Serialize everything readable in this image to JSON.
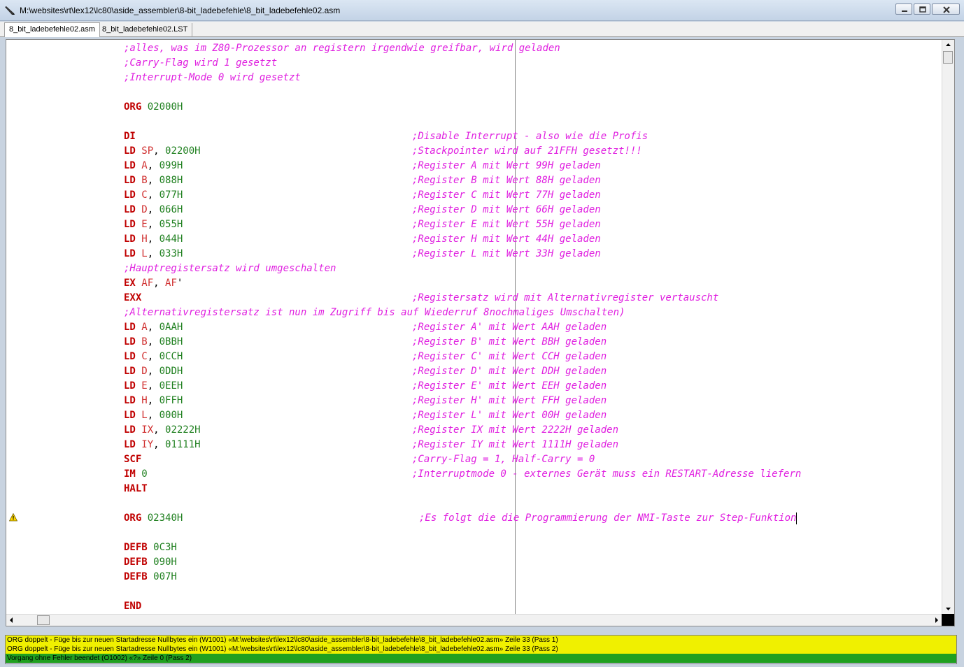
{
  "window": {
    "title": "M:\\websites\\rt\\lex12\\lc80\\aside_assembler\\8-bit_ladebefehle\\8_bit_ladebefehle02.asm"
  },
  "tabs": [
    {
      "label": "8_bit_ladebefehle02.asm",
      "active": true
    },
    {
      "label": "8_bit_ladebefehle02.LST",
      "active": false
    }
  ],
  "icons": {
    "app": "pencil-icon",
    "warning": "warning-icon",
    "minimize": "minimize-icon",
    "maximize": "maximize-icon",
    "close": "close-icon"
  },
  "colors": {
    "comment": "#e020e0",
    "keyword": "#c00000",
    "register": "#d03030",
    "number": "#208020",
    "warning_bg": "#f0f000",
    "ok_bg": "#20a020"
  },
  "code": [
    [
      {
        "t": "cm",
        "i": 1,
        "v": ";alles, was im Z80-Prozessor an registern irgendwie greifbar, wird geladen"
      }
    ],
    [
      {
        "t": "cm",
        "i": 1,
        "v": ";Carry-Flag wird 1 gesetzt"
      }
    ],
    [
      {
        "t": "cm",
        "i": 1,
        "v": ";Interrupt-Mode 0 wird gesetzt"
      }
    ],
    [],
    [
      {
        "t": "kw",
        "i": 1,
        "v": "ORG"
      },
      {
        "t": "nm",
        "v": " 02000H"
      }
    ],
    [],
    [
      {
        "t": "kw",
        "i": 1,
        "v": "DI"
      },
      {
        "t": "cm",
        "i": 2,
        "v": ";Disable Interrupt - also wie die Profis"
      }
    ],
    [
      {
        "t": "kw",
        "i": 1,
        "v": "LD"
      },
      {
        "t": "rg",
        "v": " SP"
      },
      {
        "t": "pu",
        "v": ","
      },
      {
        "t": "nm",
        "v": " 02200H"
      },
      {
        "t": "cm",
        "i": 2,
        "v": ";Stackpointer wird auf 21FFH gesetzt!!!"
      }
    ],
    [
      {
        "t": "kw",
        "i": 1,
        "v": "LD"
      },
      {
        "t": "rg",
        "v": " A"
      },
      {
        "t": "pu",
        "v": ","
      },
      {
        "t": "nm",
        "v": " 099H"
      },
      {
        "t": "cm",
        "i": 2,
        "v": ";Register A mit Wert 99H geladen"
      }
    ],
    [
      {
        "t": "kw",
        "i": 1,
        "v": "LD"
      },
      {
        "t": "rg",
        "v": " B"
      },
      {
        "t": "pu",
        "v": ","
      },
      {
        "t": "nm",
        "v": " 088H"
      },
      {
        "t": "cm",
        "i": 2,
        "v": ";Register B mit Wert 88H geladen"
      }
    ],
    [
      {
        "t": "kw",
        "i": 1,
        "v": "LD"
      },
      {
        "t": "rg",
        "v": " C"
      },
      {
        "t": "pu",
        "v": ","
      },
      {
        "t": "nm",
        "v": " 077H"
      },
      {
        "t": "cm",
        "i": 2,
        "v": ";Register C mit Wert 77H geladen"
      }
    ],
    [
      {
        "t": "kw",
        "i": 1,
        "v": "LD"
      },
      {
        "t": "rg",
        "v": " D"
      },
      {
        "t": "pu",
        "v": ","
      },
      {
        "t": "nm",
        "v": " 066H"
      },
      {
        "t": "cm",
        "i": 2,
        "v": ";Register D mit Wert 66H geladen"
      }
    ],
    [
      {
        "t": "kw",
        "i": 1,
        "v": "LD"
      },
      {
        "t": "rg",
        "v": " E"
      },
      {
        "t": "pu",
        "v": ","
      },
      {
        "t": "nm",
        "v": " 055H"
      },
      {
        "t": "cm",
        "i": 2,
        "v": ";Register E mit Wert 55H geladen"
      }
    ],
    [
      {
        "t": "kw",
        "i": 1,
        "v": "LD"
      },
      {
        "t": "rg",
        "v": " H"
      },
      {
        "t": "pu",
        "v": ","
      },
      {
        "t": "nm",
        "v": " 044H"
      },
      {
        "t": "cm",
        "i": 2,
        "v": ";Register H mit Wert 44H geladen"
      }
    ],
    [
      {
        "t": "kw",
        "i": 1,
        "v": "LD"
      },
      {
        "t": "rg",
        "v": " L"
      },
      {
        "t": "pu",
        "v": ","
      },
      {
        "t": "nm",
        "v": " 033H"
      },
      {
        "t": "cm",
        "i": 2,
        "v": ";Register L mit Wert 33H geladen"
      }
    ],
    [
      {
        "t": "cm",
        "i": 1,
        "v": ";Hauptregistersatz wird umgeschalten"
      }
    ],
    [
      {
        "t": "kw",
        "i": 1,
        "v": "EX"
      },
      {
        "t": "rg",
        "v": " AF"
      },
      {
        "t": "pu",
        "v": ","
      },
      {
        "t": "rg",
        "v": " AF"
      },
      {
        "t": "pu",
        "v": "'"
      }
    ],
    [
      {
        "t": "kw",
        "i": 1,
        "v": "EXX"
      },
      {
        "t": "cm",
        "i": 2,
        "v": ";Registersatz wird mit Alternativregister vertauscht"
      }
    ],
    [
      {
        "t": "cm",
        "i": 1,
        "v": ";Alternativregistersatz ist nun im Zugriff bis auf Wiederruf 8nochmaliges Umschalten)"
      }
    ],
    [
      {
        "t": "kw",
        "i": 1,
        "v": "LD"
      },
      {
        "t": "rg",
        "v": " A"
      },
      {
        "t": "pu",
        "v": ","
      },
      {
        "t": "nm",
        "v": " 0AAH"
      },
      {
        "t": "cm",
        "i": 2,
        "v": ";Register A' mit Wert AAH geladen"
      }
    ],
    [
      {
        "t": "kw",
        "i": 1,
        "v": "LD"
      },
      {
        "t": "rg",
        "v": " B"
      },
      {
        "t": "pu",
        "v": ","
      },
      {
        "t": "nm",
        "v": " 0BBH"
      },
      {
        "t": "cm",
        "i": 2,
        "v": ";Register B' mit Wert BBH geladen"
      }
    ],
    [
      {
        "t": "kw",
        "i": 1,
        "v": "LD"
      },
      {
        "t": "rg",
        "v": " C"
      },
      {
        "t": "pu",
        "v": ","
      },
      {
        "t": "nm",
        "v": " 0CCH"
      },
      {
        "t": "cm",
        "i": 2,
        "v": ";Register C' mit Wert CCH geladen"
      }
    ],
    [
      {
        "t": "kw",
        "i": 1,
        "v": "LD"
      },
      {
        "t": "rg",
        "v": " D"
      },
      {
        "t": "pu",
        "v": ","
      },
      {
        "t": "nm",
        "v": " 0DDH"
      },
      {
        "t": "cm",
        "i": 2,
        "v": ";Register D' mit Wert DDH geladen"
      }
    ],
    [
      {
        "t": "kw",
        "i": 1,
        "v": "LD"
      },
      {
        "t": "rg",
        "v": " E"
      },
      {
        "t": "pu",
        "v": ","
      },
      {
        "t": "nm",
        "v": " 0EEH"
      },
      {
        "t": "cm",
        "i": 2,
        "v": ";Register E' mit Wert EEH geladen"
      }
    ],
    [
      {
        "t": "kw",
        "i": 1,
        "v": "LD"
      },
      {
        "t": "rg",
        "v": " H"
      },
      {
        "t": "pu",
        "v": ","
      },
      {
        "t": "nm",
        "v": " 0FFH"
      },
      {
        "t": "cm",
        "i": 2,
        "v": ";Register H' mit Wert FFH geladen"
      }
    ],
    [
      {
        "t": "kw",
        "i": 1,
        "v": "LD"
      },
      {
        "t": "rg",
        "v": " L"
      },
      {
        "t": "pu",
        "v": ","
      },
      {
        "t": "nm",
        "v": " 000H"
      },
      {
        "t": "cm",
        "i": 2,
        "v": ";Register L' mit Wert 00H geladen"
      }
    ],
    [
      {
        "t": "kw",
        "i": 1,
        "v": "LD"
      },
      {
        "t": "rg",
        "v": " IX"
      },
      {
        "t": "pu",
        "v": ","
      },
      {
        "t": "nm",
        "v": " 02222H"
      },
      {
        "t": "cm",
        "i": 2,
        "v": ";Register IX mit Wert 2222H geladen"
      }
    ],
    [
      {
        "t": "kw",
        "i": 1,
        "v": "LD"
      },
      {
        "t": "rg",
        "v": " IY"
      },
      {
        "t": "pu",
        "v": ","
      },
      {
        "t": "nm",
        "v": " 01111H"
      },
      {
        "t": "cm",
        "i": 2,
        "v": ";Register IY mit Wert 1111H geladen"
      }
    ],
    [
      {
        "t": "kw",
        "i": 1,
        "v": "SCF"
      },
      {
        "t": "cm",
        "i": 2,
        "v": ";Carry-Flag = 1, Half-Carry = 0"
      }
    ],
    [
      {
        "t": "kw",
        "i": 1,
        "v": "IM"
      },
      {
        "t": "nm",
        "v": " 0"
      },
      {
        "t": "cm",
        "i": 2,
        "v": ";Interruptmode 0 - externes Gerät muss ein RESTART-Adresse liefern"
      }
    ],
    [
      {
        "t": "kw",
        "i": 1,
        "v": "HALT"
      }
    ],
    [],
    [
      {
        "t": "kw",
        "i": 1,
        "v": "ORG"
      },
      {
        "t": "nm",
        "v": " 02340H"
      },
      {
        "t": "cm",
        "i": 3,
        "v": ";Es folgt die die Programmierung der NMI-Taste zur Step-Funktion",
        "caret": true
      }
    ],
    [],
    [
      {
        "t": "kw",
        "i": 1,
        "v": "DEFB"
      },
      {
        "t": "nm",
        "v": " 0C3H"
      }
    ],
    [
      {
        "t": "kw",
        "i": 1,
        "v": "DEFB"
      },
      {
        "t": "nm",
        "v": " 090H"
      }
    ],
    [
      {
        "t": "kw",
        "i": 1,
        "v": "DEFB"
      },
      {
        "t": "nm",
        "v": " 007H"
      }
    ],
    [],
    [
      {
        "t": "kw",
        "i": 1,
        "v": "END"
      }
    ]
  ],
  "messages": [
    {
      "type": "warning",
      "text": "ORG doppelt - Füge bis zur neuen Startadresse Nullbytes ein (W1001) «M:\\websites\\rt\\lex12\\lc80\\aside_assembler\\8-bit_ladebefehle\\8_bit_ladebefehle02.asm» Zeile 33 (Pass 1)"
    },
    {
      "type": "warning",
      "text": "ORG doppelt - Füge bis zur neuen Startadresse Nullbytes ein (W1001) «M:\\websites\\rt\\lex12\\lc80\\aside_assembler\\8-bit_ladebefehle\\8_bit_ladebefehle02.asm» Zeile 33 (Pass 2)"
    },
    {
      "type": "ok",
      "text": "Vorgang ohne Fehler beendet (O1002) «?» Zeile 0 (Pass 2)"
    }
  ]
}
